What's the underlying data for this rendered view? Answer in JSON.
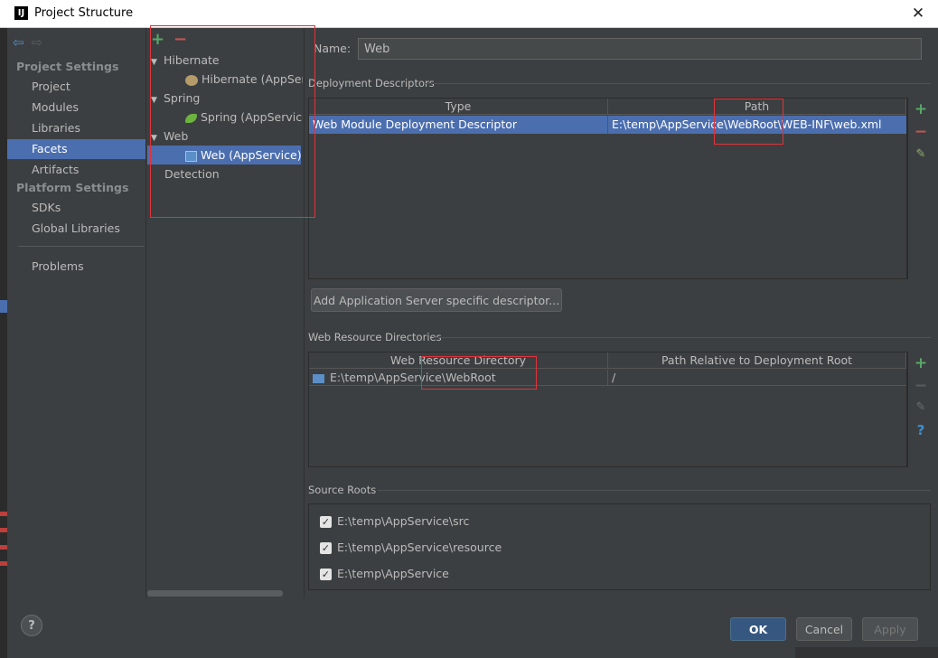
{
  "window": {
    "title": "Project Structure",
    "app_icon": "IJ",
    "close_icon": "✕"
  },
  "nav": {
    "back_icon": "back-arrow",
    "forward_icon": "forward-arrow",
    "project_settings_header": "Project Settings",
    "project_items": [
      "Project",
      "Modules",
      "Libraries",
      "Facets",
      "Artifacts"
    ],
    "platform_settings_header": "Platform Settings",
    "platform_items": [
      "SDKs",
      "Global Libraries"
    ],
    "problems": "Problems",
    "selected": "Facets"
  },
  "tree": {
    "add_icon": "+",
    "remove_icon": "−",
    "nodes": [
      {
        "label": "Hibernate",
        "child": "Hibernate (AppService)"
      },
      {
        "label": "Spring",
        "child": "Spring (AppService)"
      },
      {
        "label": "Web",
        "child": "Web (AppService)"
      }
    ],
    "detection": "Detection"
  },
  "name_field": {
    "label": "Name:",
    "value": "Web"
  },
  "deployment": {
    "group_title": "Deployment Descriptors",
    "columns": [
      "Type",
      "Path"
    ],
    "rows": [
      {
        "type": "Web Module Deployment Descriptor",
        "path": "E:\\temp\\AppService\\WebRoot\\WEB-INF\\web.xml"
      }
    ],
    "add_descriptor_button": "Add Application Server specific descriptor..."
  },
  "web_resources": {
    "group_title": "Web Resource Directories",
    "columns": [
      "Web Resource Directory",
      "Path Relative to Deployment Root"
    ],
    "rows": [
      {
        "dir": "E:\\temp\\AppService\\WebRoot",
        "relative": "/"
      }
    ]
  },
  "source_roots": {
    "group_title": "Source Roots",
    "items": [
      "E:\\temp\\AppService\\src",
      "E:\\temp\\AppService\\resource",
      "E:\\temp\\AppService"
    ]
  },
  "buttons": {
    "ok": "OK",
    "cancel": "Cancel",
    "apply": "Apply",
    "help": "?"
  },
  "side_tools": {
    "help_glyph": "?"
  },
  "colors": {
    "selection": "#4b6eaf",
    "background": "#3c3f41",
    "add_green": "#59a869",
    "remove_red": "#c75450",
    "highlight_red": "#e0333a"
  }
}
